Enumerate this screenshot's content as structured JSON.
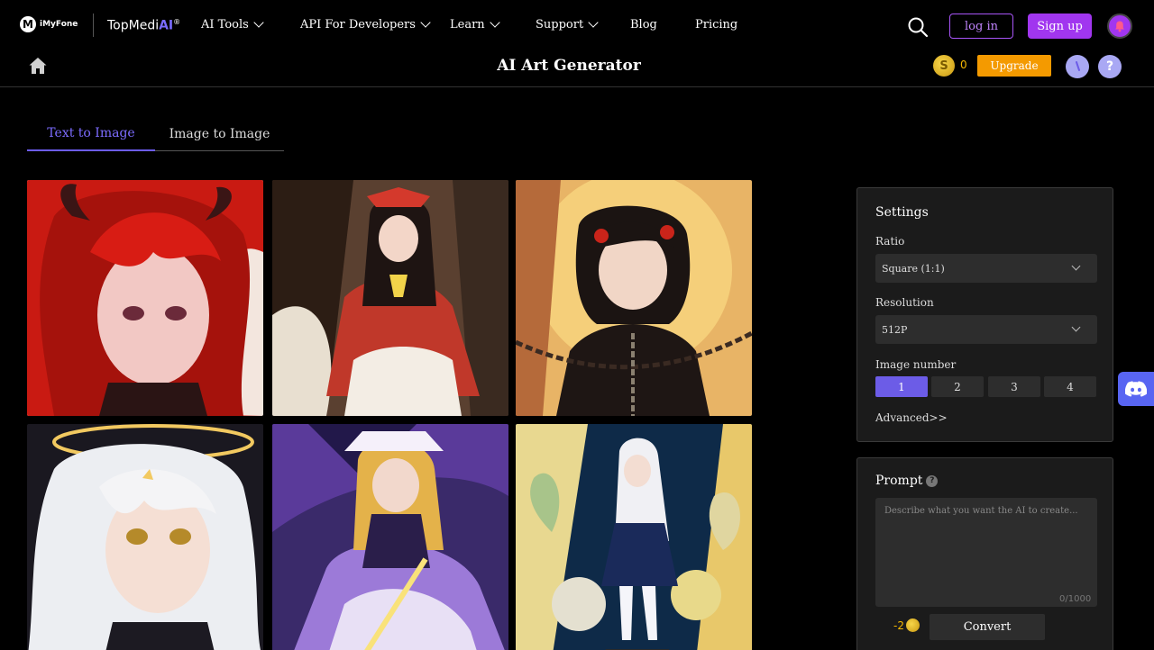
{
  "brand": {
    "imyfone": "iMyFone",
    "topmedia_prefix": "TopMedi",
    "topmedia_ai": "AI",
    "trademark": "®"
  },
  "nav": [
    {
      "label": "AI Tools",
      "has_dropdown": true
    },
    {
      "label": "API For Developers",
      "has_dropdown": true
    },
    {
      "label": "Learn",
      "has_dropdown": true
    },
    {
      "label": "Support",
      "has_dropdown": true
    },
    {
      "label": "Blog",
      "has_dropdown": false
    },
    {
      "label": "Pricing",
      "has_dropdown": false
    }
  ],
  "auth": {
    "login": "log in",
    "signup": "Sign up"
  },
  "subbar": {
    "title": "AI Art Generator",
    "coin_symbol": "S",
    "coin_count": "0",
    "upgrade": "Upgrade",
    "history_glyph": "\\",
    "help_glyph": "?"
  },
  "tabs": [
    {
      "label": "Text to Image",
      "active": true
    },
    {
      "label": "Image to Image",
      "active": false
    }
  ],
  "gallery": [
    {
      "icon": "anime-portrait-red-horns"
    },
    {
      "icon": "anime-shrine-maiden-red"
    },
    {
      "icon": "anime-girl-chains-golden"
    },
    {
      "icon": "anime-girl-white-hair-halo"
    },
    {
      "icon": "anime-witch-purple"
    },
    {
      "icon": "anime-girl-flowers-blue"
    }
  ],
  "settings": {
    "title": "Settings",
    "ratio_label": "Ratio",
    "ratio_value": "Square (1:1)",
    "resolution_label": "Resolution",
    "resolution_value": "512P",
    "image_number_label": "Image number",
    "image_numbers": [
      "1",
      "2",
      "3",
      "4"
    ],
    "selected_number": "1",
    "advanced": "Advanced>>"
  },
  "prompt": {
    "title": "Prompt",
    "help": "?",
    "placeholder": "Describe what you want the AI to create...",
    "counter": "0/1000",
    "cost": "-2",
    "convert": "Convert"
  },
  "colors": {
    "accent_purple": "#a136ef",
    "tab_active": "#7c6cff",
    "upgrade_orange": "#f49a00",
    "coin_gold": "#f5b800",
    "discord": "#5865f2",
    "panel_bg": "#1b1b1b"
  }
}
